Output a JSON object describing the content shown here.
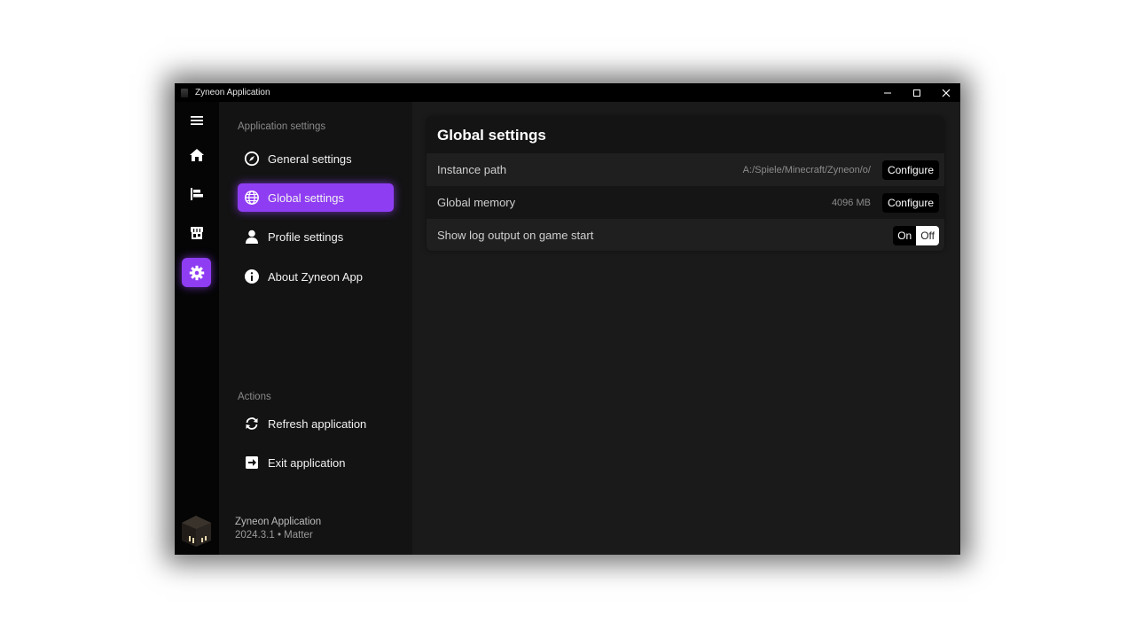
{
  "window": {
    "title": "Zyneon Application",
    "controls": [
      "minimize-icon",
      "maximize-icon",
      "close-icon"
    ]
  },
  "rail": {
    "items": [
      {
        "icon": "menu-icon"
      },
      {
        "icon": "home-icon"
      },
      {
        "icon": "library-icon"
      },
      {
        "icon": "store-icon"
      },
      {
        "icon": "gear-icon",
        "active": true
      }
    ]
  },
  "sidebar": {
    "app_section": "Application settings",
    "items": [
      {
        "label": "General settings",
        "icon": "compass-icon"
      },
      {
        "label": "Global settings",
        "icon": "globe-icon",
        "active": true
      },
      {
        "label": "Profile settings",
        "icon": "user-icon"
      },
      {
        "label": "About Zyneon App",
        "icon": "info-icon"
      }
    ],
    "actions_section": "Actions",
    "actions": [
      {
        "label": "Refresh application",
        "icon": "refresh-icon"
      },
      {
        "label": "Exit application",
        "icon": "exit-icon"
      }
    ],
    "footer": {
      "app_name": "Zyneon Application",
      "version": "2024.3.1 • Matter"
    }
  },
  "main": {
    "title": "Global settings",
    "rows": [
      {
        "label": "Instance path",
        "value": "A:/Spiele/Minecraft/Zyneon/o/",
        "button": "Configure"
      },
      {
        "label": "Global memory",
        "value": "4096 MB",
        "button": "Configure"
      },
      {
        "label": "Show log output on game start",
        "toggle_on": "On",
        "toggle_off": "Off",
        "selected": "Off"
      }
    ]
  },
  "colors": {
    "accent": "#8f3df3",
    "background": "#1a1a1a",
    "sidebar": "#131313"
  }
}
